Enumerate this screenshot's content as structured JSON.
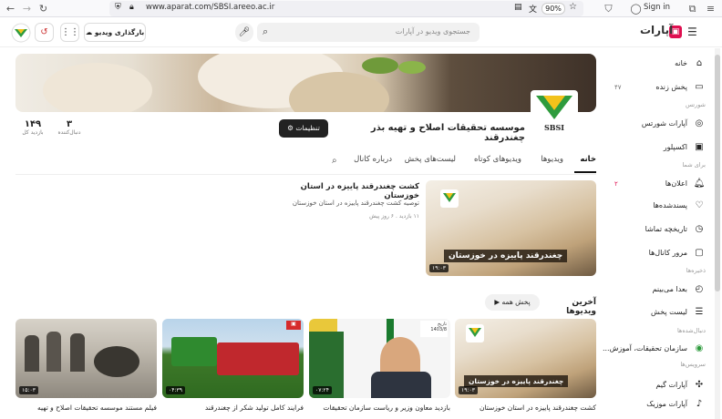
{
  "browser": {
    "url": "www.aparat.com/SBSI.areeo.ac.ir",
    "zoom": "90%",
    "sign_in": "Sign in"
  },
  "header": {
    "logo": "آپارات",
    "search_placeholder": "جستجوی ویدیو در آپارات",
    "upload_label": "بارگذاری ویدیو"
  },
  "sidebar": {
    "items": [
      {
        "label": "خانه",
        "icon": "home-icon"
      },
      {
        "label": "پخش زنده",
        "icon": "live-icon",
        "badge": "۴۷"
      },
      {
        "head": "شورتس"
      },
      {
        "label": "آپارات شورتس",
        "icon": "shorts-icon"
      },
      {
        "label": "اکسپلور",
        "icon": "explore-icon"
      },
      {
        "head": "برای شما"
      },
      {
        "label": "اعلان‌ها",
        "icon": "bell-icon",
        "badge": "۲"
      },
      {
        "label": "پسندشده‌ها",
        "icon": "heart-icon"
      },
      {
        "label": "تاریخچه تماشا",
        "icon": "history-icon"
      },
      {
        "label": "مرور کانال‌ها",
        "icon": "channels-icon"
      },
      {
        "head": "ذخیره‌ها"
      },
      {
        "label": "بعدا می‌بینم",
        "icon": "clock-icon"
      },
      {
        "label": "لیست پخش",
        "icon": "playlist-icon"
      },
      {
        "head": "دنبال‌شده‌ها"
      },
      {
        "label": "سازمان تحقیقات، آموزش...",
        "icon": "org-avatar-icon"
      },
      {
        "head": "سرویس‌ها"
      },
      {
        "label": "آپارات گیم",
        "icon": "game-icon"
      },
      {
        "label": "آپارات موزیک",
        "icon": "music-icon"
      }
    ]
  },
  "channel": {
    "name": "موسسه تحقیقات اصلاح و تهیه بذر چغندرقند",
    "logo_text": "SBSI",
    "settings_label": "تنظیمات",
    "followers_count": "۳",
    "followers_label": "دنبال‌کننده",
    "views_count": "۱۴۹",
    "views_label": "بازدید کل"
  },
  "tabs": [
    "خانه",
    "ویدیوها",
    "ویدیوهای کوتاه",
    "لیست‌های پخش",
    "درباره کانال"
  ],
  "featured": {
    "title": "کشت چغندرقند پاییزه در استان خوزستان",
    "description": "توصیه کشت چغندرقند پاییزه در استان خوزستان",
    "meta": "۱۱ بازدید . ۶ روز پیش",
    "caption": "چغندرقند پاییزه در خوزستان",
    "duration": "۱۹:۰۳"
  },
  "latest": {
    "title": "آخرین ویدیوها",
    "play_all": "پخش همه",
    "videos": [
      {
        "title": "کشت چغندرقند پاییزه در استان خوزستان",
        "duration": "۱۹:۰۳",
        "caption": "چغندرقند پاییزه در خوزستان"
      },
      {
        "title": "بازدید معاون وزیر و ریاست سازمان تحقیقات",
        "duration": "۰۷:۲۴",
        "subtitle": "تاریخ 1403/8 "
      },
      {
        "title": "فرایند کامل تولید شکر از چغندرقند",
        "duration": "۰۴:۳۹"
      },
      {
        "title": "فیلم مستند موسسه تحقیقات اصلاح و تهیه",
        "duration": "۱۵:۰۳"
      }
    ]
  }
}
